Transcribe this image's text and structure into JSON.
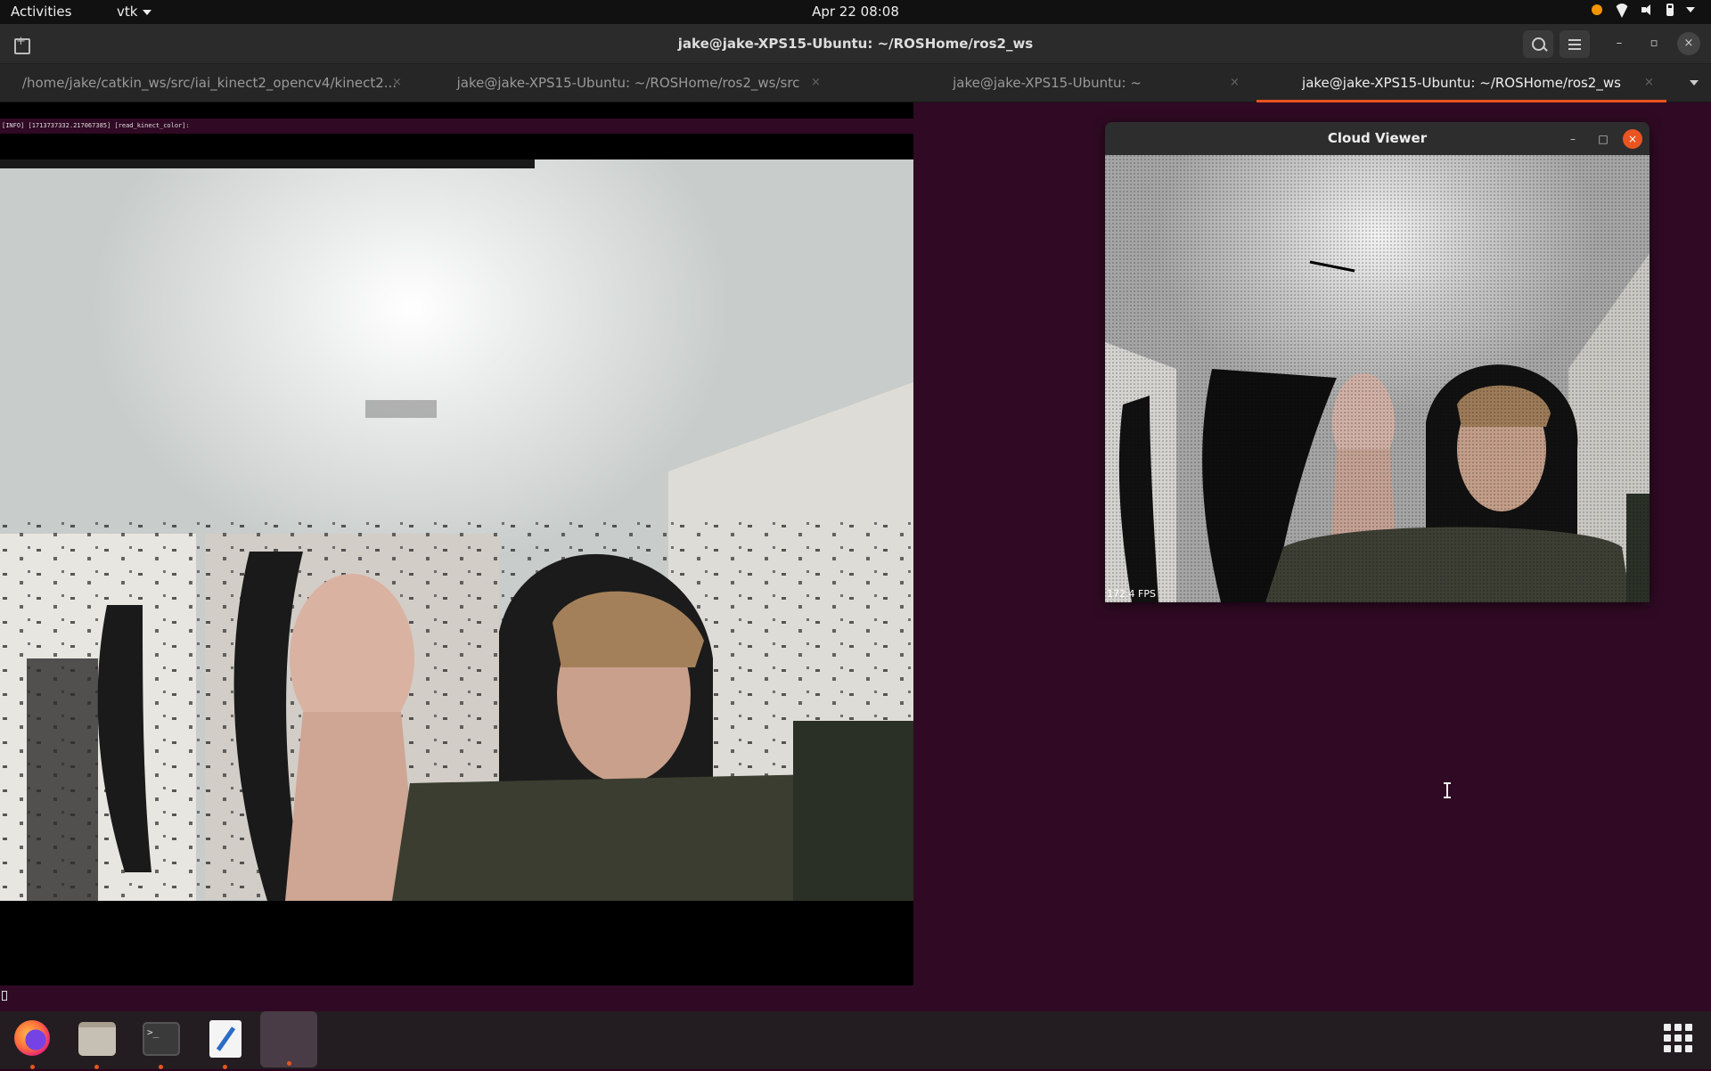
{
  "topbar": {
    "activities": "Activities",
    "app_menu": "vtk",
    "clock": "Apr 22  08:08",
    "tray_icons": [
      "notification-dot-icon",
      "wifi-icon",
      "volume-icon",
      "battery-icon",
      "system-menu-caret-icon"
    ],
    "notification_color": "#f29500"
  },
  "terminal": {
    "title": "jake@jake-XPS15-Ubuntu: ~/ROSHome/ros2_ws",
    "tabs": [
      {
        "label": "/home/jake/catkin_ws/src/iai_kinect2_opencv4/kinect2...",
        "close": "×",
        "active": false
      },
      {
        "label": "jake@jake-XPS15-Ubuntu: ~/ROSHome/ros2_ws/src",
        "close": "×",
        "active": false
      },
      {
        "label": "jake@jake-XPS15-Ubuntu: ~",
        "close": "×",
        "active": false
      },
      {
        "label": "jake@jake-XPS15-Ubuntu: ~/ROSHome/ros2_ws",
        "close": "×",
        "active": true
      }
    ],
    "log_line": "[INFO] [1713737332.217067385] [read_kinect_color]:",
    "accent_color": "#e95420",
    "background_color": "#300a24"
  },
  "cloud_viewer": {
    "title": "Cloud Viewer",
    "fps": "172.4 FPS",
    "minimize": "–",
    "maximize": "□",
    "close": "×"
  },
  "window_controls": {
    "minimize": "–",
    "maximize": "▫",
    "close": "×"
  },
  "dock": {
    "items": [
      "firefox-icon",
      "files-icon",
      "terminal-icon",
      "text-editor-icon",
      "vtk-app-icon"
    ],
    "terminal_glyph": ">_",
    "show_apps": "show-applications-icon"
  }
}
